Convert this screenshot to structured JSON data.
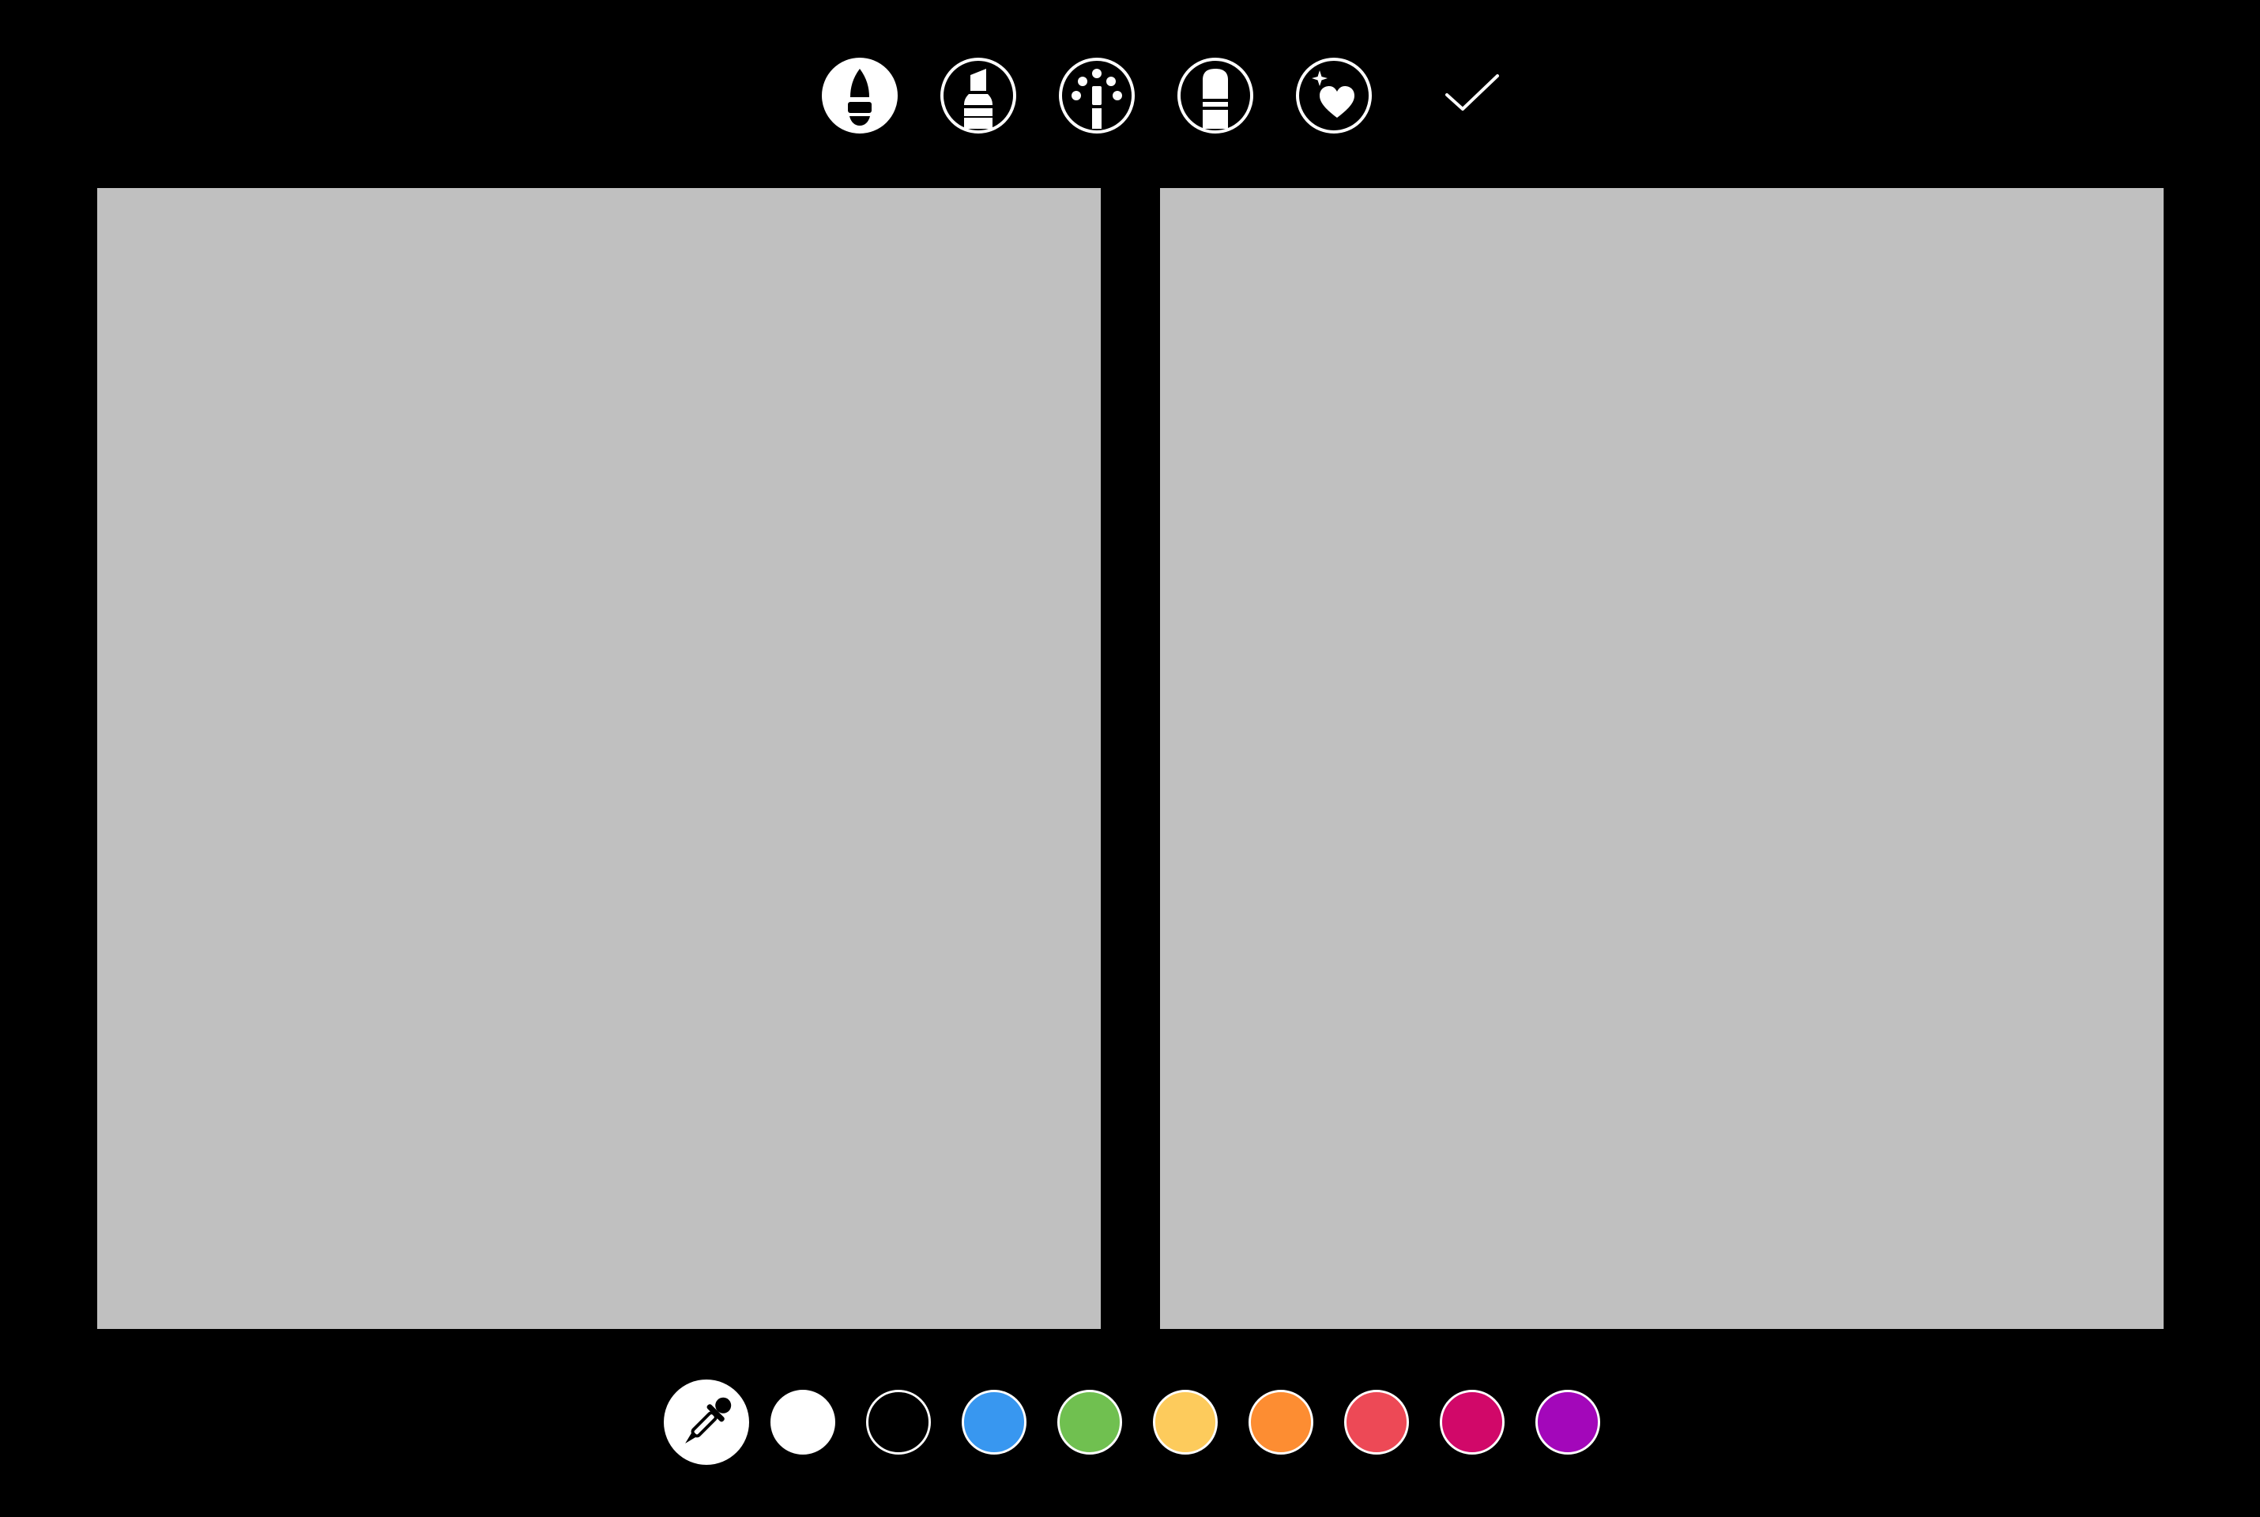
{
  "toolbar": {
    "tools": [
      {
        "name": "pen",
        "icon": "pen-icon",
        "selected": true
      },
      {
        "name": "marker",
        "icon": "marker-icon",
        "selected": false
      },
      {
        "name": "neon",
        "icon": "neon-brush-icon",
        "selected": false
      },
      {
        "name": "eraser",
        "icon": "eraser-icon",
        "selected": false
      },
      {
        "name": "effects",
        "icon": "sparkle-heart-icon",
        "selected": false
      }
    ],
    "done_icon": "checkmark-icon"
  },
  "canvases": {
    "fill_color": "#c0c0c0",
    "count": 2
  },
  "palette": {
    "eyedropper_icon": "eyedropper-icon",
    "colors": [
      "#ffffff",
      "#000000",
      "#3897f0",
      "#70c050",
      "#fdcb5c",
      "#fd8d32",
      "#ed4956",
      "#d10869",
      "#a307ba"
    ]
  },
  "theme": {
    "background": "#000000",
    "foreground": "#ffffff"
  }
}
